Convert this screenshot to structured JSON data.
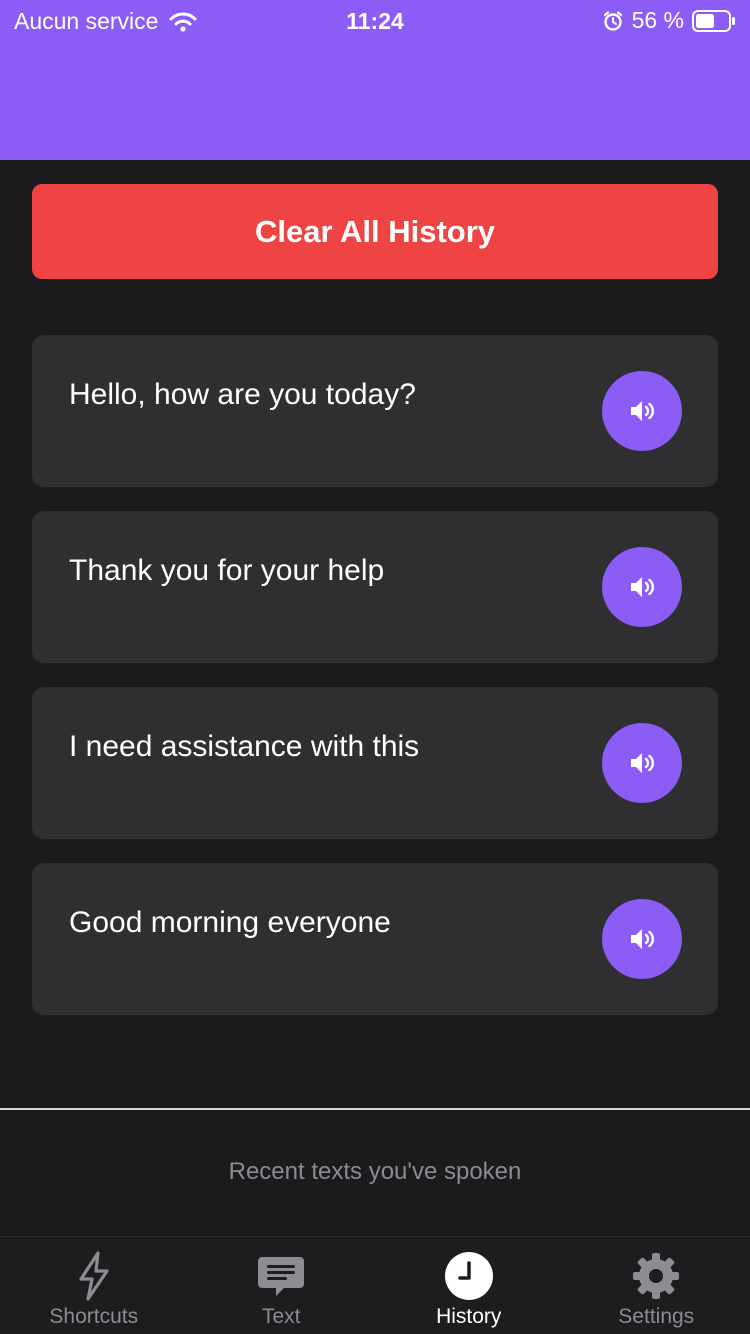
{
  "status_bar": {
    "carrier": "Aucun service",
    "time": "11:24",
    "battery": "56 %"
  },
  "actions": {
    "clear_label": "Clear All History"
  },
  "history": [
    {
      "text": "Hello, how are you today?"
    },
    {
      "text": "Thank you for your help"
    },
    {
      "text": "I need assistance with this"
    },
    {
      "text": "Good morning everyone"
    }
  ],
  "footer": {
    "caption": "Recent texts you've spoken"
  },
  "tabs": [
    {
      "label": "Shortcuts",
      "icon": "lightning-icon",
      "active": false
    },
    {
      "label": "Text",
      "icon": "chat-icon",
      "active": false
    },
    {
      "label": "History",
      "icon": "clock-icon",
      "active": true
    },
    {
      "label": "Settings",
      "icon": "gear-icon",
      "active": false
    }
  ],
  "colors": {
    "accent": "#8b5cf6",
    "danger": "#ef4444",
    "background": "#1b1b1d",
    "card": "#2f2e30"
  }
}
